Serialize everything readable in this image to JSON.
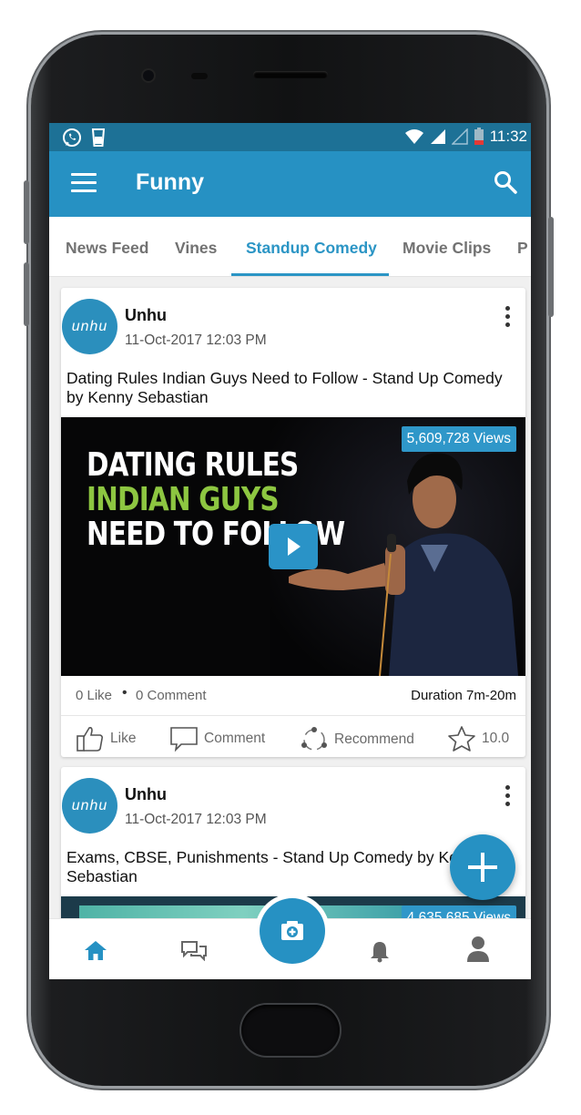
{
  "status_bar": {
    "time": "11:32"
  },
  "app_bar": {
    "title": "Funny",
    "icons": [
      "menu-icon",
      "search-icon"
    ]
  },
  "tabs": [
    "News Feed",
    "Vines",
    "Standup Comedy",
    "Movie Clips",
    "P"
  ],
  "active_tab": "Standup Comedy",
  "posts": [
    {
      "avatar_text": "unhu",
      "author": "Unhu",
      "date": "11-Oct-2017 12:03 PM",
      "title": "Dating Rules Indian Guys Need to Follow - Stand Up Comedy by Kenny Sebastian",
      "views": "5,609,728 Views",
      "thumbnail_lines": [
        "DATING RULES",
        "INDIAN GUYS",
        "NEED TO FOLLOW"
      ],
      "likes": "0 Like",
      "separator": "•",
      "comments": "0 Comment",
      "duration": "Duration 7m-20m",
      "actions": {
        "like": "Like",
        "comment": "Comment",
        "recommend": "Recommend",
        "rating": "10.0"
      }
    },
    {
      "avatar_text": "unhu",
      "author": "Unhu",
      "date": "11-Oct-2017 12:03 PM",
      "title": "Exams, CBSE, Punishments - Stand Up Comedy by Kenny Sebastian",
      "views": "4,635,685 Views"
    }
  ],
  "bottom_nav": [
    "home-icon",
    "chat-icon",
    "camera-icon",
    "bell-icon",
    "profile-icon"
  ],
  "colors": {
    "primary": "#2691c3",
    "status_bar": "#1d7196",
    "accent_text": "#2b95c5",
    "thumb_green": "#8dc641"
  }
}
